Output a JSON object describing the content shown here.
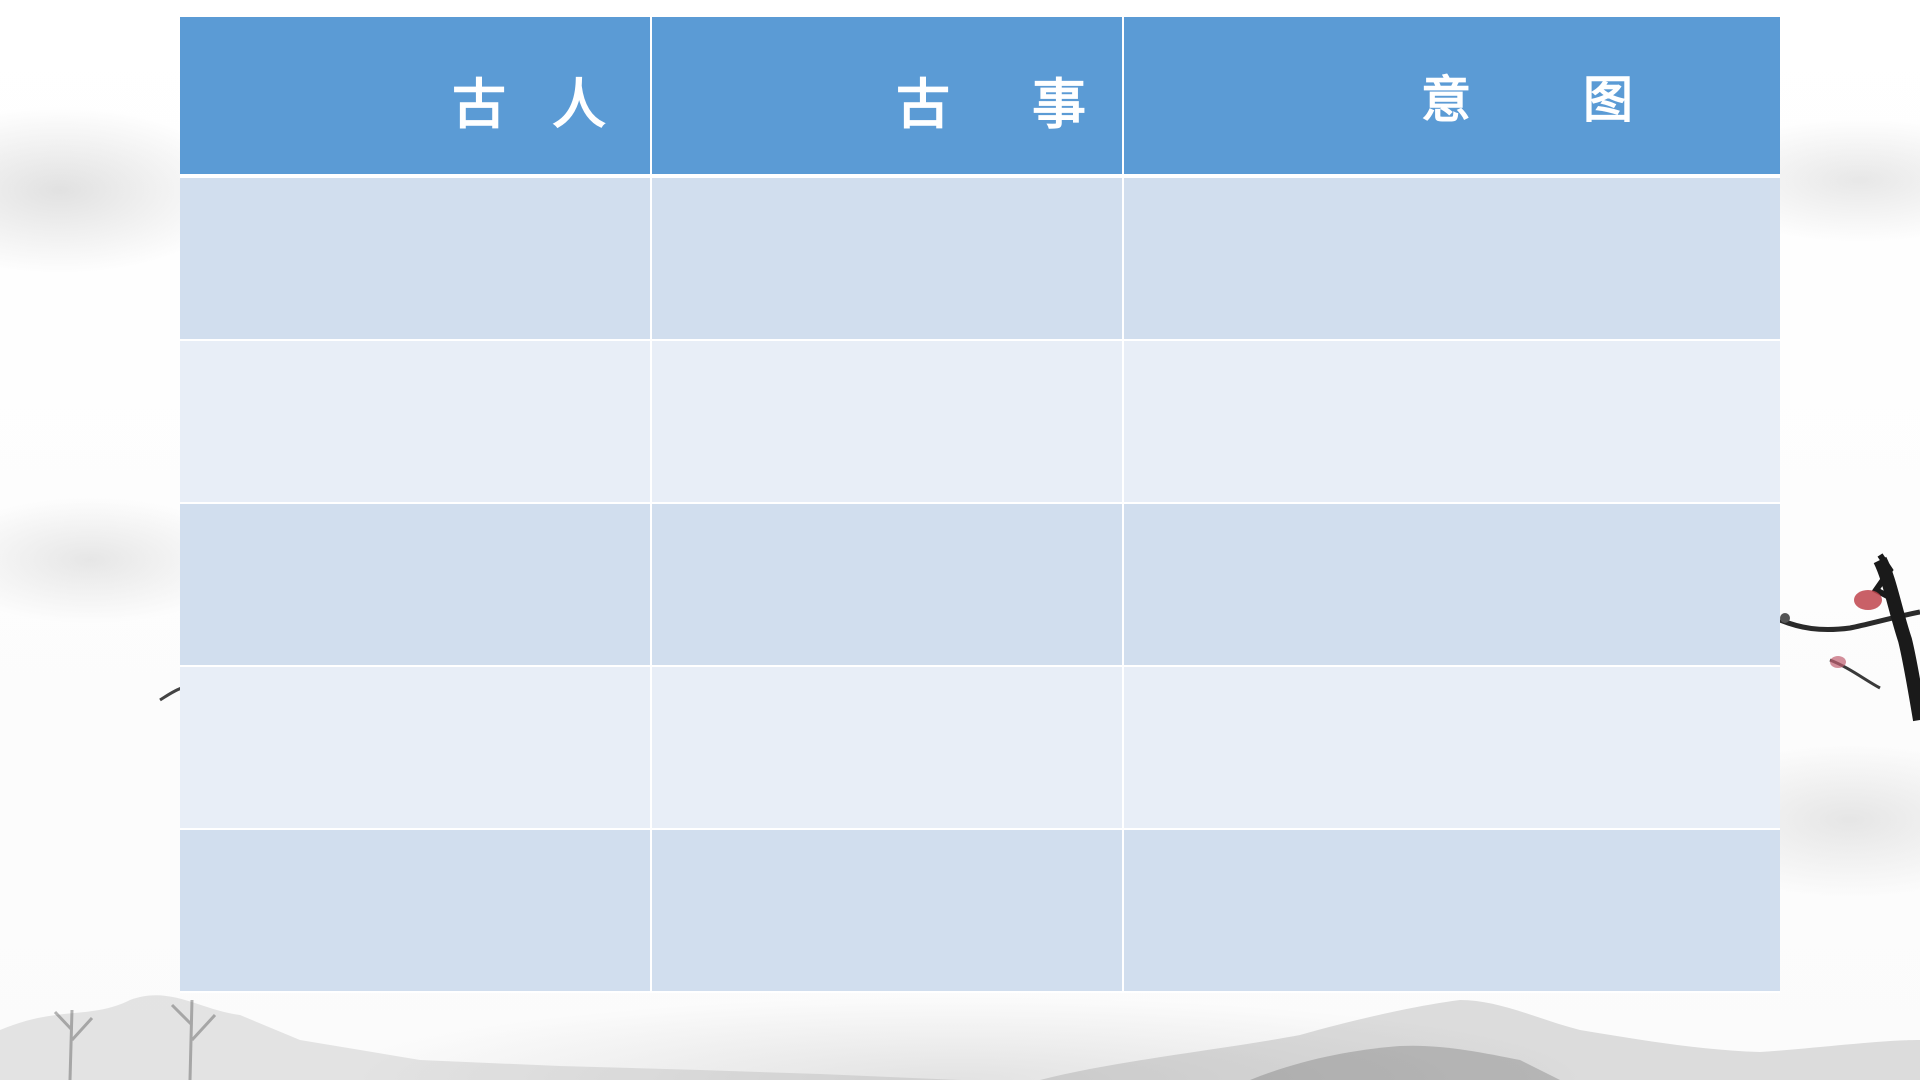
{
  "table": {
    "headers": [
      "古人",
      "古事",
      "意图"
    ],
    "rows": [
      [
        "",
        "",
        ""
      ],
      [
        "",
        "",
        ""
      ],
      [
        "",
        "",
        ""
      ],
      [
        "",
        "",
        ""
      ],
      [
        "",
        "",
        ""
      ]
    ]
  },
  "colors": {
    "header_bg": "#5b9bd5",
    "header_text": "#ffffff",
    "row_dark": "#d1deee",
    "row_light": "#e8eef7"
  }
}
